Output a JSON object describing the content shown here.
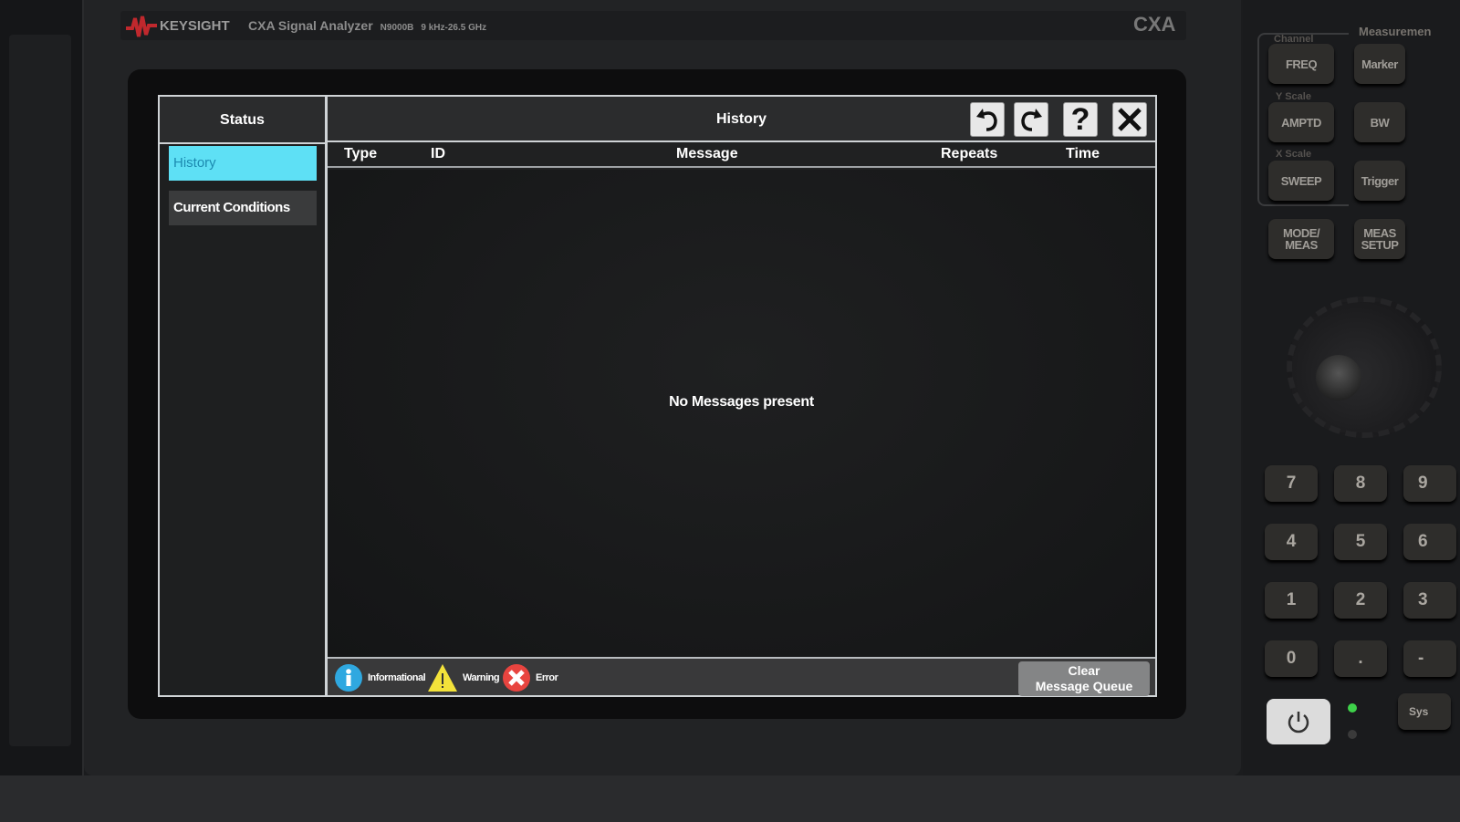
{
  "instrument": {
    "brand": "KEYSIGHT",
    "model_name": "CXA Signal Analyzer",
    "model_number": "N9000B",
    "range": "9 kHz-26.5 GHz",
    "badge": "CXA",
    "brand_color": "#c0282d"
  },
  "sidebar": {
    "title": "Status",
    "items": [
      {
        "label": "History",
        "selected": true
      },
      {
        "label": "Current Conditions",
        "selected": false
      }
    ],
    "selected_color": "#5ee0f5"
  },
  "main": {
    "title": "History",
    "toolbar": {
      "undo": "undo-icon",
      "redo": "redo-icon",
      "help": "?",
      "close": "close-icon"
    },
    "columns": [
      "Type",
      "ID",
      "Message",
      "Repeats",
      "Time"
    ],
    "empty_message": "No Messages present",
    "legend": [
      {
        "label": "Informational",
        "icon": "info-icon",
        "color": "#2fa8e0"
      },
      {
        "label": "Warning",
        "icon": "warning-icon",
        "color": "#f3e23a"
      },
      {
        "label": "Error",
        "icon": "error-icon",
        "color": "#e8443f"
      }
    ],
    "clear_button": {
      "line1": "Clear",
      "line2": "Message Queue"
    }
  },
  "front_panel": {
    "group_labels": {
      "channel": "Channel",
      "y_scale": "Y Scale",
      "x_scale": "X Scale",
      "measurement": "Measuremen"
    },
    "keys": {
      "freq": "FREQ",
      "marker": "Marker",
      "amptd": "AMPTD",
      "bw": "BW",
      "sweep": "SWEEP",
      "trigger": "Trigger",
      "mode1": "MODE/",
      "mode2": "MEAS",
      "setup1": "MEAS",
      "setup2": "SETUP"
    },
    "keypad": [
      "7",
      "8",
      "9",
      "4",
      "5",
      "6",
      "1",
      "2",
      "3",
      "0",
      ".",
      "-"
    ],
    "system_key": "Sys"
  }
}
